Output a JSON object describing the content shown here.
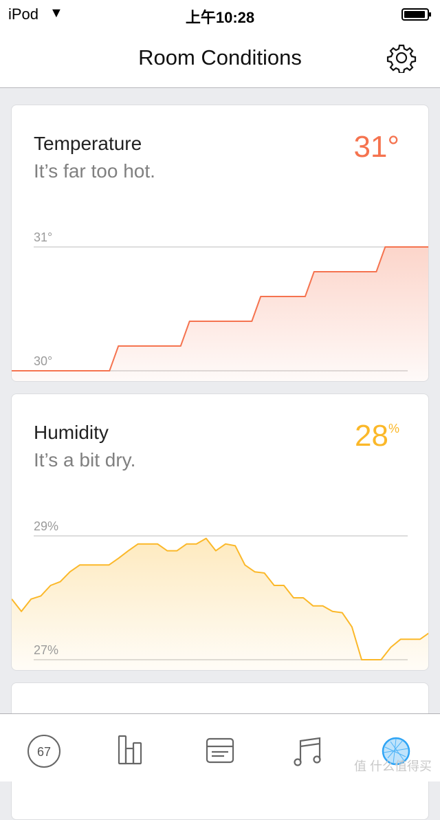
{
  "status_bar": {
    "carrier": "iPod",
    "time": "上午10:28",
    "battery_level": 0.95
  },
  "nav": {
    "title": "Room Conditions",
    "settings_icon": "gear-icon"
  },
  "cards": [
    {
      "title": "Temperature",
      "subtitle": "It’s far too hot.",
      "value": "31°",
      "color": "#f5734f",
      "chart_data": {
        "type": "area",
        "ylim": [
          30,
          31
        ],
        "ticks": [
          "31°",
          "30°"
        ],
        "grid": true,
        "values": [
          30,
          30,
          30,
          30,
          30,
          30,
          30,
          30,
          30,
          30,
          30,
          30,
          30.2,
          30.2,
          30.2,
          30.2,
          30.2,
          30.2,
          30.2,
          30.2,
          30.4,
          30.4,
          30.4,
          30.4,
          30.4,
          30.4,
          30.4,
          30.4,
          30.6,
          30.6,
          30.6,
          30.6,
          30.6,
          30.6,
          30.8,
          30.8,
          30.8,
          30.8,
          30.8,
          30.8,
          30.8,
          30.8,
          31,
          31,
          31,
          31,
          31,
          31
        ]
      }
    },
    {
      "title": "Humidity",
      "subtitle": "It’s a bit dry.",
      "value": "28",
      "unit": "%",
      "color": "#fbb829",
      "chart_data": {
        "type": "area",
        "ylim": [
          27,
          29
        ],
        "ticks": [
          "29%",
          "27%"
        ],
        "grid": true,
        "values": [
          27.98,
          27.78,
          27.98,
          28.03,
          28.2,
          28.26,
          28.42,
          28.53,
          28.53,
          28.53,
          28.53,
          28.64,
          28.76,
          28.87,
          28.87,
          28.87,
          28.76,
          28.76,
          28.87,
          28.87,
          28.96,
          28.76,
          28.87,
          28.84,
          28.53,
          28.42,
          28.4,
          28.2,
          28.2,
          28.0,
          28.0,
          27.87,
          27.87,
          27.78,
          27.76,
          27.53,
          27.0,
          27.0,
          27.0,
          27.2,
          27.33,
          27.33,
          27.33,
          27.44
        ]
      }
    }
  ],
  "tabbar": {
    "items": [
      {
        "name": "score",
        "label": "67"
      },
      {
        "name": "stats"
      },
      {
        "name": "card"
      },
      {
        "name": "music"
      },
      {
        "name": "globe",
        "active": true
      }
    ]
  },
  "watermark": "值 什么值得买"
}
